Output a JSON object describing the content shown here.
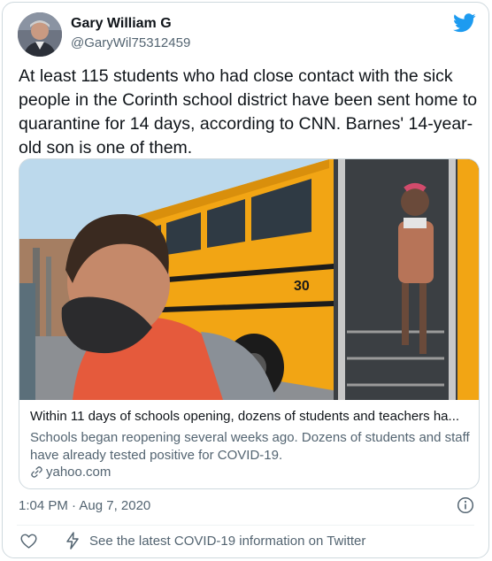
{
  "author": {
    "name": "Gary William G",
    "handle": "@GaryWil75312459"
  },
  "tweet": {
    "text": "At least 115 students who had close contact with the sick people in the Corinth school district have been sent home to quarantine for 14 days, according to CNN. Barnes' 14-year-old son is one of them."
  },
  "link_card": {
    "image_subject": "students exiting a yellow school bus wearing face masks",
    "bus_number": "30",
    "title": "Within 11 days of schools opening, dozens of students and teachers ha...",
    "description": "Schools began reopening several weeks ago. Dozens of students and staff have already tested positive for COVID-19.",
    "domain": "yahoo.com"
  },
  "footer": {
    "timestamp": "1:04 PM · Aug 7, 2020",
    "covid_link": "See the latest COVID-19 information on Twitter"
  },
  "icons": {
    "brand": "twitter-bird-icon",
    "info": "info-icon",
    "like": "heart-icon",
    "covid": "lightning-bolt-icon",
    "link": "link-icon"
  },
  "colors": {
    "twitter_blue": "#1d9bf0",
    "text_primary": "#0f1419",
    "text_secondary": "#536471",
    "border": "#cfd9de",
    "bus_yellow": "#f2a514"
  }
}
